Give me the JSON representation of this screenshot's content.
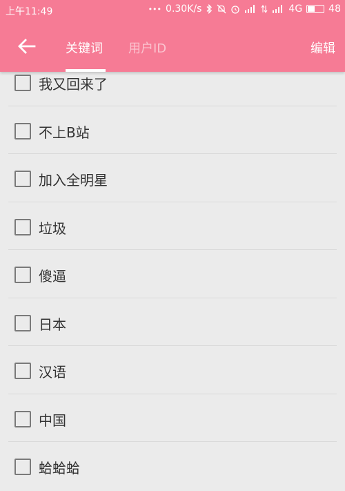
{
  "status_bar": {
    "time": "上午11:49",
    "dots": "•••",
    "net_speed": "0.30K/s",
    "network": "4G",
    "battery": "48",
    "battery_level": 0.48,
    "icons": [
      "bluetooth-icon",
      "mute-icon",
      "alarm-icon",
      "signal-icon",
      "signal-icon",
      "data-arrows-icon"
    ]
  },
  "toolbar": {
    "back_icon": "arrow-left-icon",
    "tabs": [
      {
        "label": "关键词",
        "active": true
      },
      {
        "label": "用户ID",
        "active": false
      }
    ],
    "edit_label": "编辑"
  },
  "list": {
    "items": [
      {
        "label": "我又回来了",
        "checked": false
      },
      {
        "label": "不上B站",
        "checked": false
      },
      {
        "label": "加入全明星",
        "checked": false
      },
      {
        "label": "垃圾",
        "checked": false
      },
      {
        "label": "傻逼",
        "checked": false
      },
      {
        "label": "日本",
        "checked": false
      },
      {
        "label": "汉语",
        "checked": false
      },
      {
        "label": "中国",
        "checked": false
      },
      {
        "label": "蛤蛤蛤",
        "checked": false
      }
    ]
  },
  "colors": {
    "accent": "#f67b95",
    "background": "#ebebeb",
    "text": "#333333",
    "checkbox_border": "#7a7a7a"
  }
}
